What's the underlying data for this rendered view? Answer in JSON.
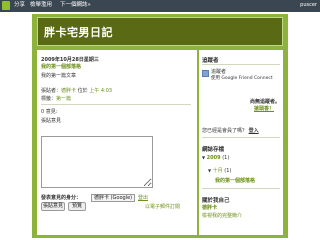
{
  "navbar": {
    "logo_icon": "blogger-logo-icon",
    "links": [
      "分享",
      "檢舉濫用",
      "下一個網誌»"
    ],
    "right_text": "puscer"
  },
  "header": {
    "title": "胖卡宅男日記"
  },
  "post": {
    "date": "2009年10月28日星期三",
    "title": "我的第一個部落格",
    "body": "我的第一篇文章",
    "byline_prefix": "張貼者：",
    "author": "德胖卡",
    "at": "位於",
    "time": "上午 4:03",
    "labels_prefix": "標籤：",
    "label": "第一篇"
  },
  "comments": {
    "heading": "0 意見:",
    "post_comment": "張貼意見",
    "identity_label": "發表意見的身分：",
    "identity_value": "德胖卡 (Google)",
    "logout": "登出",
    "publish_button": "張貼意見",
    "preview_button": "預覽",
    "subscribe_link": "以電子郵件訂閱"
  },
  "sidebar": {
    "followers_heading": "追蹤者",
    "followers_label": "追蹤者",
    "gfc_text": "使用 Google Friend Connect",
    "no_followers": "尚無追蹤者。",
    "be_first": "搶頭香！",
    "already_member": "您已經是會員了嗎？",
    "login": "登入",
    "archive_heading": "網誌存檔",
    "archive_year": "2009",
    "archive_year_count": "(1)",
    "archive_month": "十月",
    "archive_month_count": "(1)",
    "archive_post": "我的第一個部落格",
    "about_heading": "關於我自己",
    "about_name": "德胖卡",
    "about_profile": "檢視我的完整簡介"
  },
  "colors": {
    "frame_green": "#8db33a",
    "header_olive": "#5a6a14",
    "link_green": "#6d8f1c",
    "navbar": "#3a4752"
  }
}
